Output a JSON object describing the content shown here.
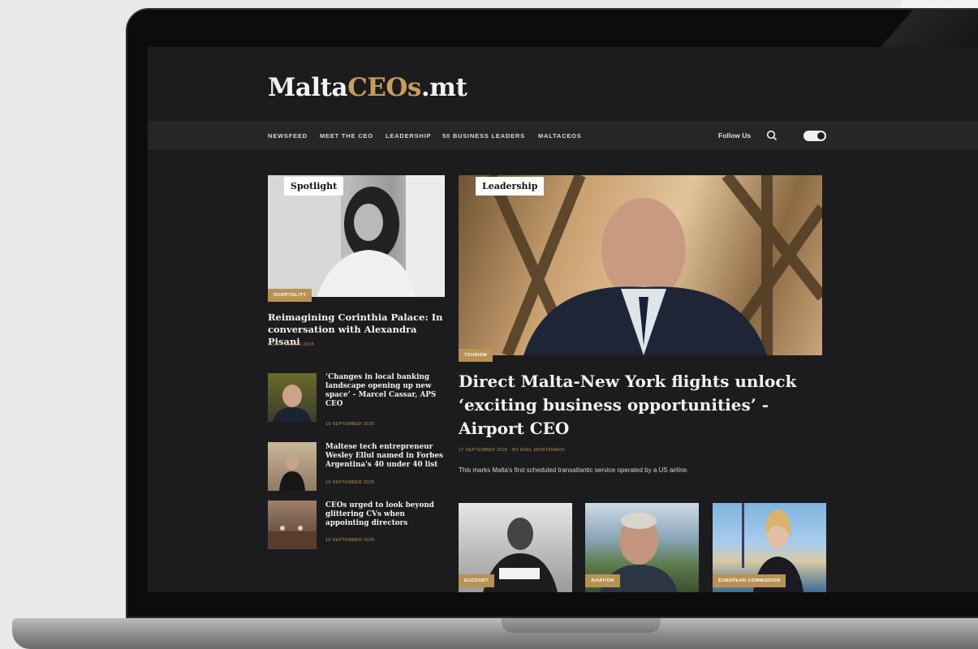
{
  "site": {
    "logo_main": "Malta",
    "logo_accent": "CEOs",
    "logo_suffix": ".mt"
  },
  "nav": {
    "items": [
      "NEWSFEED",
      "MEET THE CEO",
      "LEADERSHIP",
      "50 BUSINESS LEADERS",
      "MALTACEOS"
    ],
    "follow_label": "Follow Us"
  },
  "spotlight": {
    "tag": "Spotlight",
    "category": "HOSPITALITY",
    "title": "Reimagining Corinthia Palace: In conversation with Alexandra Pisani",
    "date": "9 SEPTEMBER 2025"
  },
  "lead": {
    "tag": "Leadership",
    "category": "TOURISM",
    "title": "Direct Malta-New York flights unlock ‘exciting business opportunities’ - Airport CEO",
    "meta": "17 SEPTEMBER 2025 · BY ADEL MONTANARO",
    "summary": "This marks Malta's first scheduled transatlantic service operated by a US airline."
  },
  "side_articles": [
    {
      "title": "‘Changes in local banking landscape opening up new space’ - Marcel Cassar, APS CEO",
      "date": "19 SEPTEMBER 2025"
    },
    {
      "title": "Maltese tech entrepreneur Wesley Ellul named in Forbes Argentina's 40 under 40 list",
      "date": "15 SEPTEMBER 2025"
    },
    {
      "title": "CEOs urged to look beyond glittering CVs when appointing directors",
      "date": "16 SEPTEMBER 2025"
    }
  ],
  "bottom_cards": [
    {
      "category": "EUCOURT"
    },
    {
      "category": "AVIATION"
    },
    {
      "category": "EUROPEAN COMMISSION"
    }
  ],
  "colors": {
    "accent": "#c59d5f",
    "background": "#1c1c1e",
    "navbar": "#262628"
  }
}
